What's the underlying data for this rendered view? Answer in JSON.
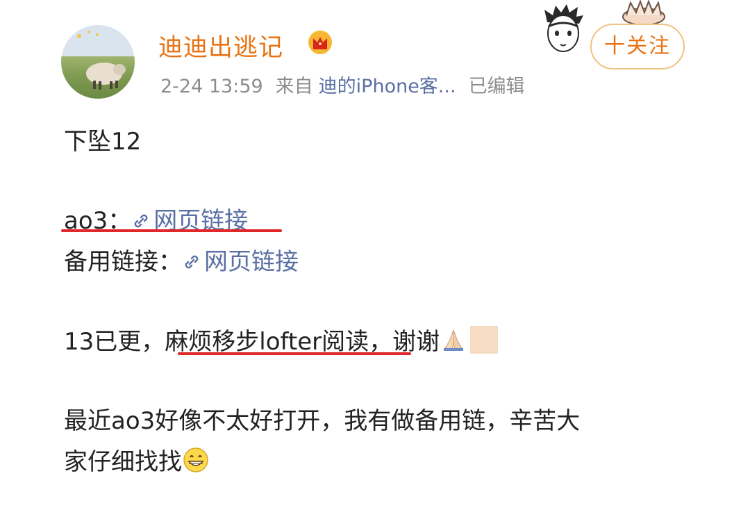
{
  "header": {
    "username": "迪迪出逃记",
    "timestamp": "2-24 13:59",
    "source_prefix": "来自",
    "source_app": "迪的iPhone客...",
    "edited": "已编辑",
    "follow_label": "十关注"
  },
  "post": {
    "line1": "下坠12",
    "line2_label": "ao3：",
    "line2_link": "网页链接",
    "line3_label": "备用链接：",
    "line3_link": "网页链接",
    "line4_a": "13已更，",
    "line4_b": "麻烦移步lofter阅读",
    "line4_c": "，谢谢",
    "line5": "最近ao3好像不太好打开，我有做备用链，辛苦大",
    "line6": "家仔细找找"
  },
  "colors": {
    "username": "#e97312",
    "link": "#5a6fa3",
    "meta": "#8c8c8c",
    "underline": "#e0282a",
    "follow_border": "#f1c281"
  },
  "icons": [
    "crown-icon",
    "link-icon",
    "praying-hands-emoji",
    "grin-emoji",
    "sticker-face",
    "sticker-flower"
  ]
}
